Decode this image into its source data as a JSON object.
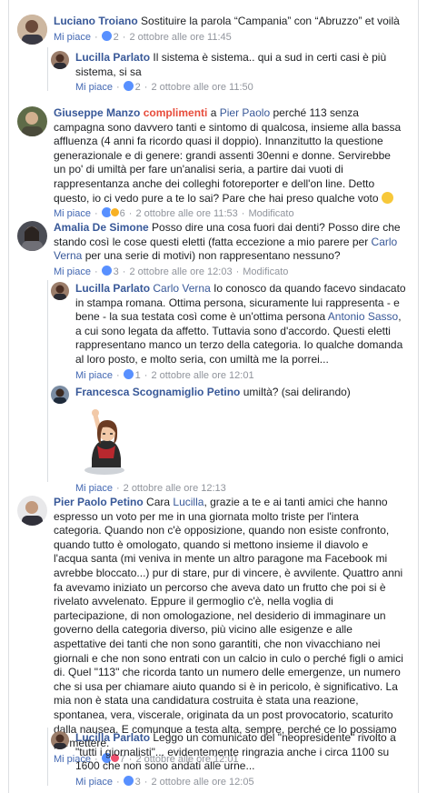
{
  "comments": [
    {
      "name": "Luciano Troiano",
      "text": "Sostituire la parola “Campania” con “Abruzzo” et voilà",
      "like": "Mi piace",
      "reactions": "2",
      "time": "2 ottobre alle ore 11:45"
    },
    {
      "name": "Lucilla Parlato",
      "text": "Il sistema è sistema.. qui a sud in certi casi è più sistema, si sa",
      "like": "Mi piace",
      "reactions": "2",
      "time": "2 ottobre alle ore 11:50"
    },
    {
      "name": "Giuseppe Manzo",
      "badge": "complimenti",
      "pre": "a",
      "mention": "Pier Paolo",
      "text": "perché 113 senza campagna sono davvero tanti e sintomo di qualcosa, insieme alla bassa affluenza (4 anni fa ricordo quasi il doppio). Innanzitutto la questione generazionale e di genere: grandi assenti 30enni e donne. Servirebbe un po' di umiltà per fare un'analisi seria, a partire dai vuoti di rappresentanza anche dei colleghi fotoreporter e dell'on line. Detto questo, io ci vedo pure a te lo sai? Pare che hai preso qualche voto",
      "like": "Mi piace",
      "reactions": "6",
      "time": "2 ottobre alle ore 11:53",
      "edited": "Modificato"
    },
    {
      "name": "Amalia De Simone",
      "text1": "Posso dire una cosa fuori dai denti? Posso dire che stando così le cose questi eletti (fatta eccezione a mio parere per",
      "mention": "Carlo Verna",
      "text2": "per una serie di motivi) non rappresentano nessuno?",
      "like": "Mi piace",
      "reactions": "3",
      "time": "2 ottobre alle ore 12:03",
      "edited": "Modificato"
    },
    {
      "name": "Lucilla Parlato",
      "mention": "Carlo Verna",
      "text1": "Io conosco da quando facevo sindacato in stampa romana. Ottima persona, sicuramente lui rappresenta - e bene - la sua testata così come è un'ottima persona",
      "mention2": "Antonio Sasso",
      "text2": ", a cui sono legata da affetto. Tuttavia sono d'accordo. Questi eletti rappresentano manco un terzo della categoria. Io qualche domanda al loro posto, e molto seria, con umiltà me la porrei...",
      "like": "Mi piace",
      "reactions": "1",
      "time": "2 ottobre alle ore 12:01"
    },
    {
      "name": "Francesca Scognamiglio Petino",
      "text": "umiltà? (sai delirando)",
      "like": "Mi piace",
      "time": "2 ottobre alle ore 12:13"
    },
    {
      "name": "Pier Paolo Petino",
      "pre": "Cara",
      "mention": "Lucilla",
      "text": ", grazie a te e ai tanti amici che hanno espresso un voto per me in una giornata molto triste per l'intera categoria. Quando non c'è opposizione, quando non esiste confronto, quando tutto è omologato, quando si mettono insieme il diavolo e l'acqua santa (mi veniva in mente un altro paragone ma Facebook mi avrebbe bloccato...) pur di stare, pur di vincere, è avvilente. Quattro anni fa avevamo iniziato un percorso che aveva dato un frutto che poi si è rivelato avvelenato. Eppure il germoglio c'è, nella voglia di partecipazione, di non omologazione, nel desiderio di immaginare un governo della categoria diverso, più vicino alle esigenze e alle aspettative dei tanti che non sono garantiti, che non vivacchiano nei giornali e che non sono entrati con un calcio in culo o perché figli o amici di. Quel \"113\" che ricorda tanto un numero delle emergenze, un numero che si usa per chiamare aiuto quando si è in pericolo, è significativo. La mia non è stata una candidatura costruita è stata una reazione, spontanea, vera, viscerale, originata da un post provocatorio, scaturito dalla nausea. E comunque a testa alta, sempre, perché ce lo possiamo permettere.",
      "like": "Mi piace",
      "reactions": "7",
      "time": "2 ottobre alle ore 12:01"
    },
    {
      "name": "Lucilla Parlato",
      "text": "Leggo un comunicato del \"neopresidente\" rivolto a \"tutti i giornalisti\"... evidentemente ringrazia anche i circa 1100 su 1600 che non sono andati alle urne...",
      "like": "Mi piace",
      "reactions": "3",
      "time": "2 ottobre alle ore 12:05"
    }
  ],
  "icons": [
    "avatar",
    "like-reaction-icon",
    "haha-reaction-icon",
    "smile-emoji-icon",
    "sticker"
  ]
}
